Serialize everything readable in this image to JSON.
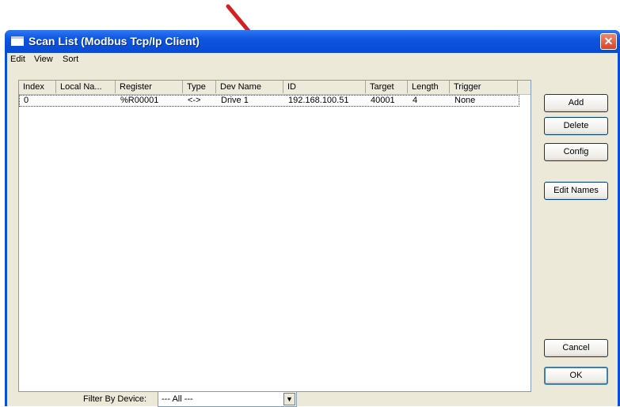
{
  "window": {
    "title": "Scan List (Modbus Tcp/Ip Client)",
    "close_glyph": "✕"
  },
  "menu": {
    "items": [
      "Edit",
      "View",
      "Sort"
    ]
  },
  "list": {
    "columns": [
      "Index",
      "Local Na...",
      "Register",
      "Type",
      "Dev Name",
      "ID",
      "Target",
      "Length",
      "Trigger"
    ],
    "rows": [
      [
        "0",
        "",
        "%R00001",
        "<->",
        "Drive 1",
        "192.168.100.51",
        "40001",
        "4",
        "None"
      ]
    ]
  },
  "buttons": {
    "add": "Add",
    "delete": "Delete",
    "config": "Config",
    "edit_names": "Edit Names",
    "cancel": "Cancel",
    "ok": "OK"
  },
  "filter": {
    "label": "Filter By Device:",
    "value": "--- All ---",
    "dropdown_glyph": "▼"
  },
  "colors": {
    "annotation_arrow": "#d42020",
    "titlebar": "#0a4fd9"
  },
  "icons": [
    "window-icon",
    "close-icon",
    "dropdown-arrow-icon",
    "annotation-arrow"
  ]
}
